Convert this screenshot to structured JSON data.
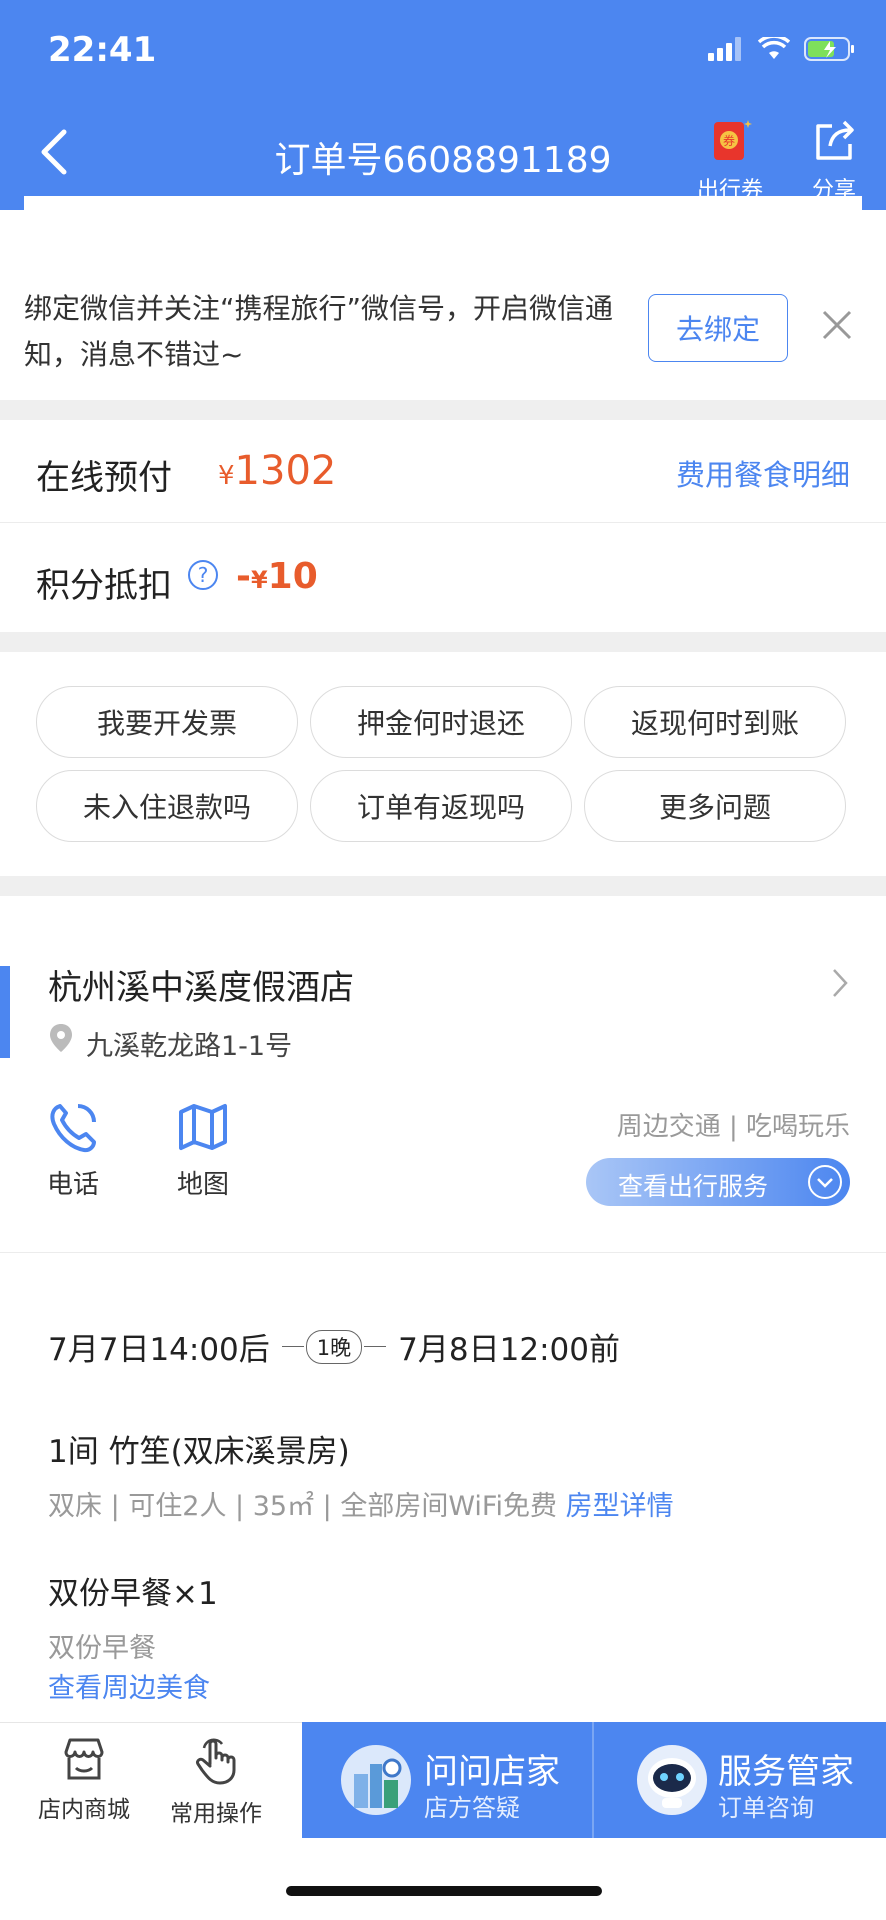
{
  "status_bar": {
    "time": "22:41"
  },
  "nav": {
    "title": "订单号6608891189",
    "coupon_label": "出行券",
    "share_label": "分享"
  },
  "bind_banner": {
    "text": "绑定微信并关注“携程旅行”微信号，开启微信通知，消息不错过~",
    "button": "去绑定"
  },
  "payment": {
    "label": "在线预付",
    "currency": "¥",
    "amount": "1302",
    "detail_link": "费用餐食明细"
  },
  "points": {
    "label": "积分抵扣",
    "help": "?",
    "minus": "-",
    "currency": "¥",
    "amount": "10"
  },
  "faq": [
    "我要开发票",
    "押金何时退还",
    "返现何时到账",
    "未入住退款吗",
    "订单有返现吗",
    "更多问题"
  ],
  "hotel": {
    "name": "杭州溪中溪度假酒店",
    "address": "九溪乾龙路1-1号",
    "phone_label": "电话",
    "map_label": "地图",
    "nearby": "周边交通 | 吃喝玩乐",
    "travel_service": "查看出行服务"
  },
  "stay": {
    "checkin": "7月7日14:00后",
    "nights": "1晚",
    "checkout": "7月8日12:00前",
    "room_title": "1间 竹笙(双床溪景房)",
    "room_info": "双床 | 可住2人 | 35㎡ | 全部房间WiFi免费",
    "room_link": "房型详情",
    "breakfast_title": "双份早餐×1",
    "breakfast_sub": "双份早餐",
    "food_link": "查看周边美食"
  },
  "bottom_bar": {
    "shop_label": "店内商城",
    "ops_label": "常用操作",
    "ask_title": "问问店家",
    "ask_sub": "店方答疑",
    "butler_title": "服务管家",
    "butler_sub": "订单咨询"
  },
  "colors": {
    "brand": "#4c86f0",
    "price": "#e85c2c"
  }
}
